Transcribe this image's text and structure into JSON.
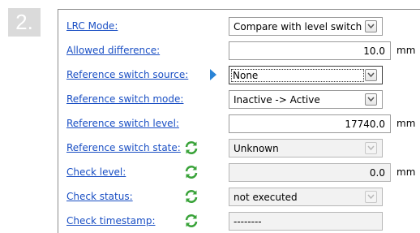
{
  "step": {
    "number": "2."
  },
  "rows": [
    {
      "label": "LRC Mode:",
      "value": "Compare with level switch",
      "kind": "select"
    },
    {
      "label": "Allowed difference:",
      "value": "10.0",
      "unit": "mm",
      "kind": "number"
    },
    {
      "label": "Reference switch source:",
      "value": "None",
      "kind": "select",
      "focused": true
    },
    {
      "label": "Reference switch mode:",
      "value": "Inactive -> Active",
      "kind": "select"
    },
    {
      "label": "Reference switch level:",
      "value": "17740.0",
      "unit": "mm",
      "kind": "number"
    },
    {
      "label": "Reference switch state:",
      "value": "Unknown",
      "kind": "select",
      "readonly": true,
      "refresh_icon": "refresh-icon"
    },
    {
      "label": "Check level:",
      "value": "0.0",
      "unit": "mm",
      "kind": "number",
      "readonly": true,
      "refresh_icon": "refresh-icon"
    },
    {
      "label": "Check status:",
      "value": "not executed",
      "kind": "select",
      "readonly": true,
      "refresh_icon": "refresh-icon"
    },
    {
      "label": "Check timestamp:",
      "value": "--------",
      "kind": "text",
      "readonly": true,
      "refresh_icon": "refresh-icon"
    }
  ],
  "colors": {
    "link": "#1a4fc4",
    "refresh": "#3aa33a",
    "marker": "#2a84d6",
    "badge": "#dadada"
  }
}
